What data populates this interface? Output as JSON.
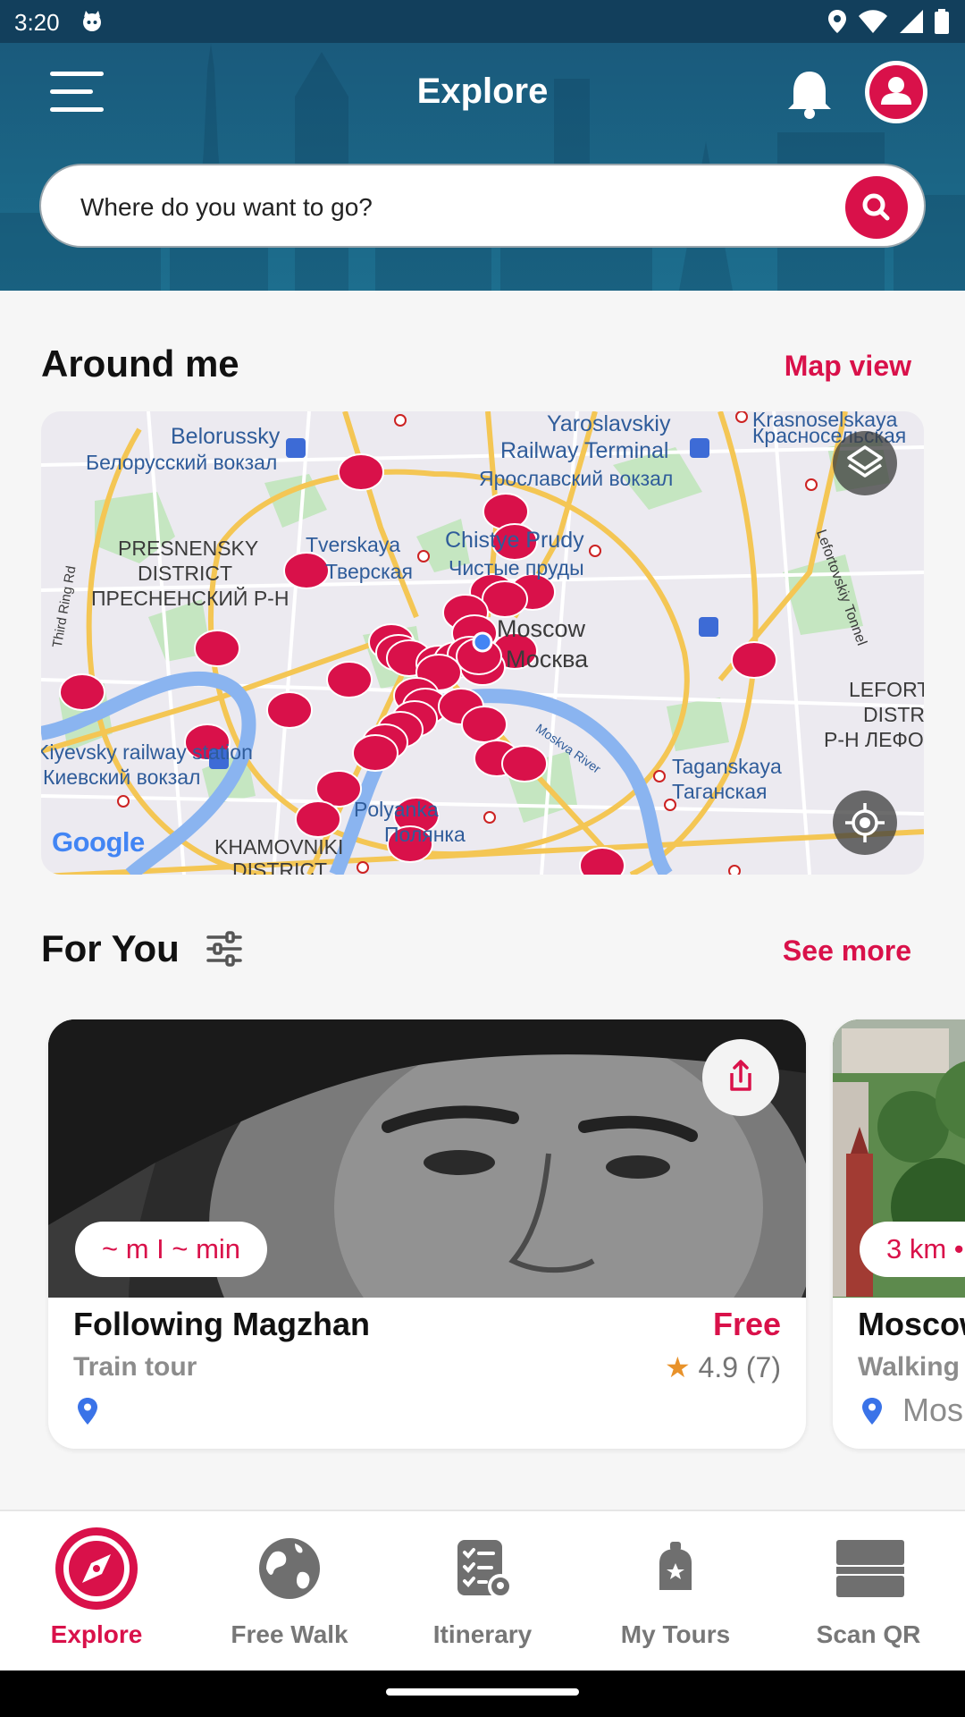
{
  "status_bar": {
    "time": "3:20"
  },
  "header": {
    "title": "Explore",
    "search": {
      "placeholder": "Where do you want to go?"
    }
  },
  "around_me": {
    "title": "Around me",
    "link": "Map view",
    "map_labels": [
      "Belorussky",
      "Белорусский вокзал",
      "Yaroslavskiy",
      "Railway Terminal",
      "Ярославский вокзал",
      "Krasnoselskaya",
      "Красносельская",
      "Lefortovskiy Tonnel",
      "PRESNENSKY",
      "DISTRICT",
      "ПРЕСНЕНСКИЙ Р-Н",
      "Tverskaya",
      "Тверская",
      "Chistye Prudy",
      "Чистые пруды",
      "Moscow",
      "Москва",
      "LEFORT",
      "DISTR",
      "Р-Н ЛЕФО",
      "Third Ring Rd",
      "Kiyevsky railway station",
      "Киевский вокзал",
      "Moskva River",
      "Taganskaya",
      "Таганская",
      "Polyanka",
      "Полянка",
      "KHAMOVNIKI",
      "DISTRICT",
      "Google"
    ]
  },
  "for_you": {
    "title": "For You",
    "link": "See more",
    "cards": [
      {
        "pill": "~ m I ~ min",
        "title": "Following Magzhan",
        "price": "Free",
        "subtitle": "Train tour",
        "rating": "4.9 (7)",
        "location": ""
      },
      {
        "pill": "3 km •",
        "title": "Moscow",
        "subtitle": "Walking",
        "location": "Mos"
      }
    ]
  },
  "bottom_nav": {
    "items": [
      {
        "label": "Explore",
        "active": true
      },
      {
        "label": "Free Walk",
        "active": false
      },
      {
        "label": "Itinerary",
        "active": false
      },
      {
        "label": "My Tours",
        "active": false
      },
      {
        "label": "Scan QR",
        "active": false
      }
    ]
  },
  "colors": {
    "accent": "#d9114a",
    "header": "#1b6585",
    "text": "#111111",
    "muted": "#8c8c8c",
    "star": "#e8922a"
  },
  "icons": [
    "menu-icon",
    "bell-icon",
    "profile-icon",
    "search-icon",
    "layers-icon",
    "locate-icon",
    "filter-icon",
    "share-icon",
    "pin-icon",
    "star-icon",
    "compass-icon",
    "globe-icon",
    "checklist-icon",
    "backpack-icon",
    "qr-icon"
  ]
}
